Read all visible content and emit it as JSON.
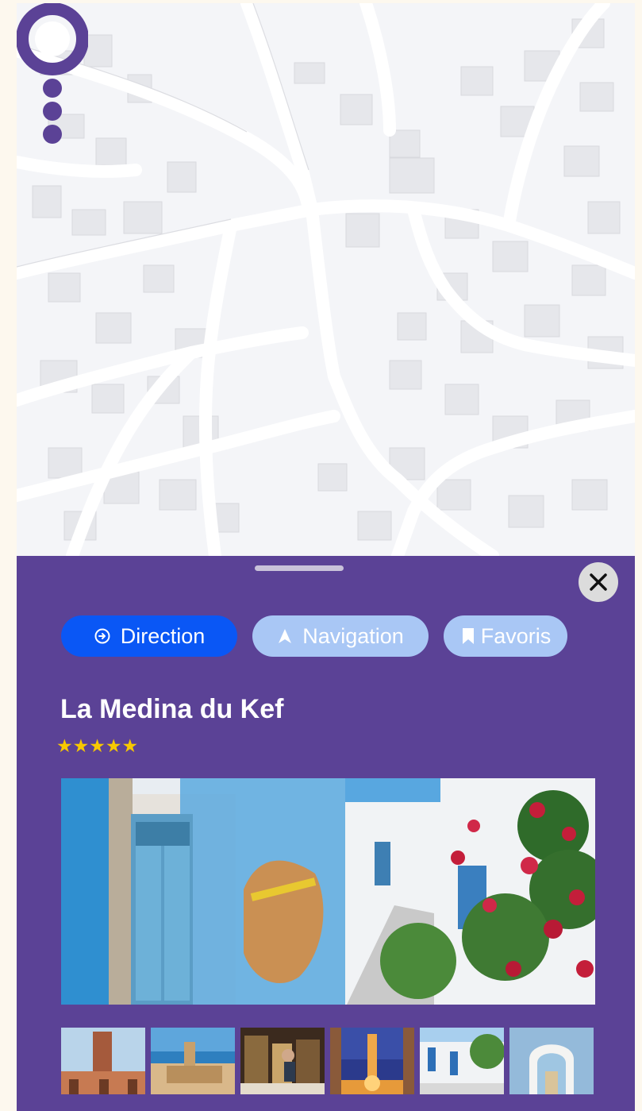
{
  "map": {
    "pin_color": "#5b4296",
    "pin_icon": "location-pin-icon"
  },
  "sheet": {
    "background": "#5b4296",
    "close_icon": "close-icon"
  },
  "actions": {
    "direction_label": "Direction",
    "direction_icon": "arrow-circle-icon",
    "navigation_label": "Navigation",
    "navigation_icon": "navigation-arrow-icon",
    "favorites_label": "Favoris",
    "favorites_icon": "bookmark-icon"
  },
  "place": {
    "name": "La Medina du Kef",
    "rating": 5,
    "stars_text": "★★★★★",
    "photo": "medina-street-photo",
    "thumbnails": [
      "clock-tower-thumbnail",
      "seaside-fort-thumbnail",
      "market-shop-thumbnail",
      "minaret-night-thumbnail",
      "white-street-thumbnail",
      "blue-archway-thumbnail"
    ]
  },
  "colors": {
    "primary_button": "#0a57f5",
    "secondary_button": "#a9c7f5",
    "star": "#f7c800"
  }
}
